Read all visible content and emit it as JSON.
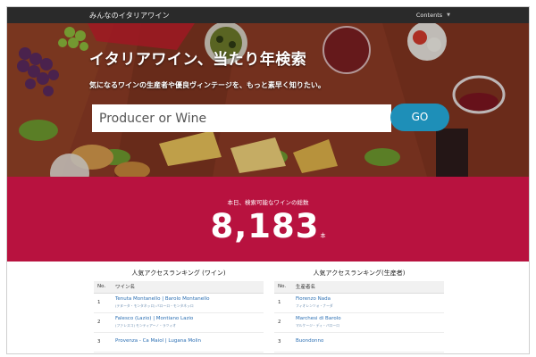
{
  "navbar": {
    "brand": "みんなのイタリアワイン",
    "menu_label": "Contents",
    "menu_caret": "▼"
  },
  "hero": {
    "title": "イタリアワイン、当たり年検索",
    "subtitle": "気になるワインの生産者や優良ヴィンテージを、もっと素早く知りたい。",
    "search_placeholder": "Producer or Wine",
    "go_label": "GO"
  },
  "stats": {
    "label": "本日、検索可能なワインの総数",
    "count": "8,183",
    "unit": "本"
  },
  "rank_wine": {
    "title": "人気アクセスランキング (ワイン)",
    "col_no": "No.",
    "col_name": "ワイン名",
    "rows": [
      {
        "no": "1",
        "name": "Tenuta Montanello | Barolo Montanello",
        "name_ja": "(テヌータ・モンタネッロ) バローロ・モンタネッロ"
      },
      {
        "no": "2",
        "name": "Falesco (Lazio) | Montiano Lazio",
        "name_ja": "(ファレスコ) モンティアーノ・ラツィオ"
      },
      {
        "no": "3",
        "name": "Provenza - Ca Maiol | Lugana Molin",
        "name_ja": ""
      }
    ]
  },
  "rank_producer": {
    "title": "人気アクセスランキング(生産者)",
    "col_no": "No.",
    "col_name": "生産者名",
    "rows": [
      {
        "no": "1",
        "name": "Fiorenzo Nada",
        "name_ja": "フィオレンツォ・ナーダ"
      },
      {
        "no": "2",
        "name": "Marchesi di Barolo",
        "name_ja": "マルケージ・ディ・バローロ"
      },
      {
        "no": "3",
        "name": "Buondonno",
        "name_ja": ""
      }
    ]
  }
}
